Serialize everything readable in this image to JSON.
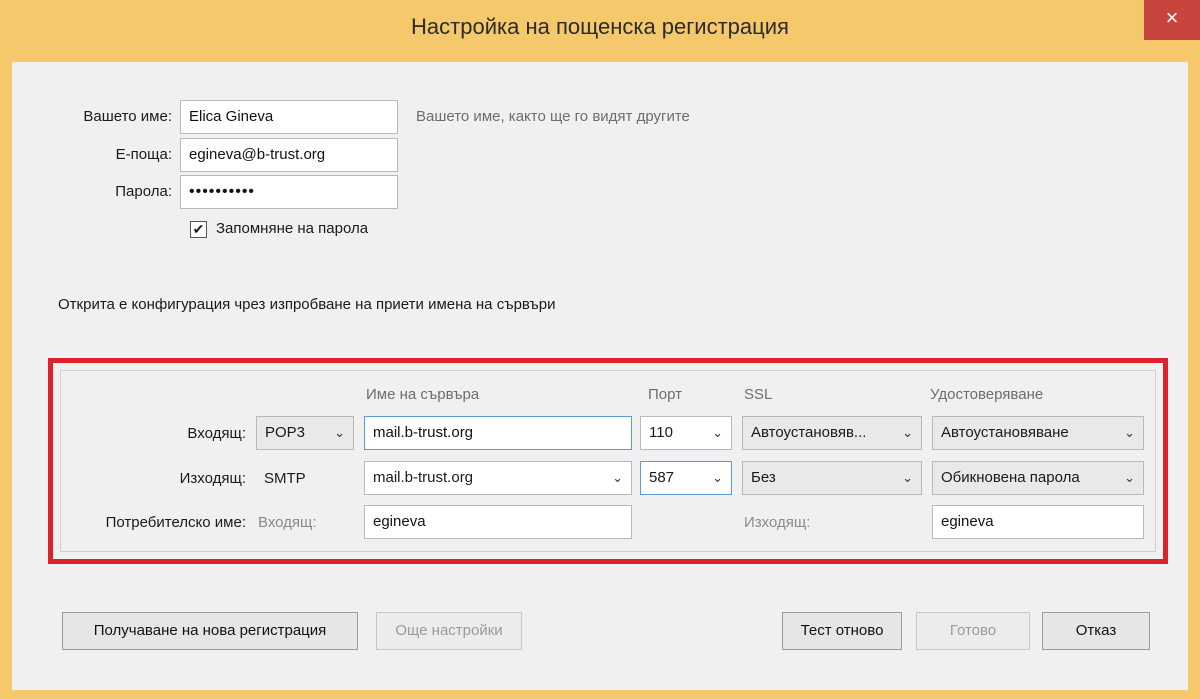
{
  "window": {
    "title": "Настройка на пощенска регистрация",
    "close_glyph": "×"
  },
  "account": {
    "name_label": "Вашето име:",
    "name_value": "Elica Gineva",
    "name_hint": "Вашето име, както ще го видят другите",
    "email_label": "Е-поща:",
    "email_value": "egineva@b-trust.org",
    "password_label": "Парола:",
    "password_value": "••••••••••",
    "remember_label": "Запомняне на парола",
    "remember_checked": true,
    "check_glyph": "✔"
  },
  "status_text": "Открита е конфигурация чрез изпробване на приети имена на сървъри",
  "servers": {
    "headers": {
      "server": "Име на сървъра",
      "port": "Порт",
      "ssl": "SSL",
      "auth": "Удостоверяване"
    },
    "incoming": {
      "label": "Входящ:",
      "protocol": "POP3",
      "server": "mail.b-trust.org",
      "port": "110",
      "ssl": "Автоустановяв...",
      "auth": "Автоустановяване"
    },
    "outgoing": {
      "label": "Изходящ:",
      "protocol": "SMTP",
      "server": "mail.b-trust.org",
      "port": "587",
      "ssl": "Без",
      "auth": "Обикновена парола"
    },
    "username": {
      "label": "Потребителско име:",
      "incoming_label": "Входящ:",
      "incoming_value": "egineva",
      "outgoing_label": "Изходящ:",
      "outgoing_value": "egineva"
    },
    "chevron": "⌄"
  },
  "buttons": {
    "new_account": "Получаване на нова регистрация",
    "more_settings": "Още настройки",
    "retest": "Тест отново",
    "done": "Готово",
    "cancel": "Отказ"
  },
  "colors": {
    "titlebar": "#f5c96b",
    "close": "#c7453d",
    "highlight": "#e0202a"
  }
}
